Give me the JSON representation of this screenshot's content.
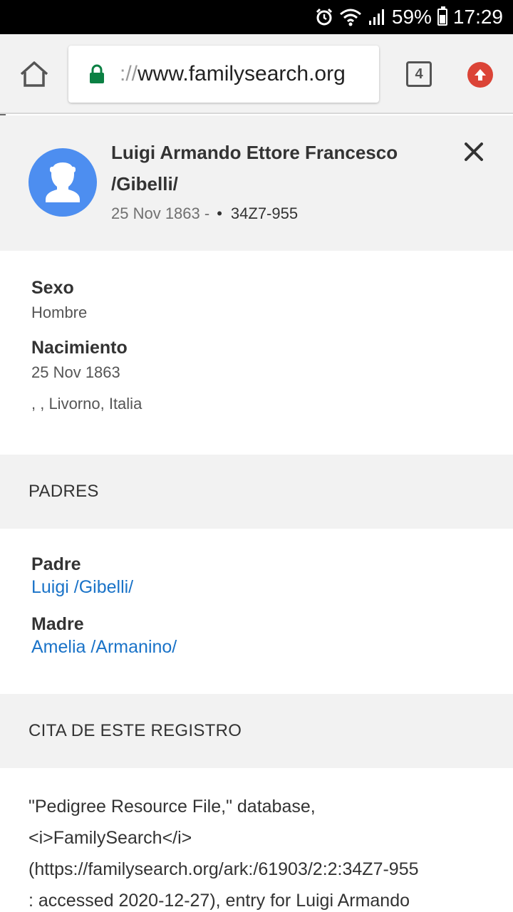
{
  "status_bar": {
    "battery": "59%",
    "time": "17:29"
  },
  "browser": {
    "url_scheme": "://",
    "url_host": "www.familysearch.org",
    "tab_count": "4"
  },
  "person": {
    "name_line1": "Luigi Armando Ettore Francesco",
    "name_line2": "/Gibelli/",
    "dates": "25 Nov 1863 -",
    "separator": "•",
    "pid": "34Z7-955"
  },
  "vitals": {
    "sex_label": "Sexo",
    "sex_value": "Hombre",
    "birth_label": "Nacimiento",
    "birth_date": "25 Nov 1863",
    "birth_place": ", , Livorno, Italia"
  },
  "parents_section": {
    "title": "PADRES",
    "father_label": "Padre",
    "father_name": "Luigi /Gibelli/",
    "mother_label": "Madre",
    "mother_name": "Amelia /Armanino/"
  },
  "citation_section": {
    "title": "CITA DE ESTE REGISTRO",
    "lines": [
      "\"Pedigree Resource File,\" database,",
      "<i>FamilySearch</i>",
      "(https://familysearch.org/ark:/61903/2:2:34Z7-955",
      ": accessed 2020-12-27), entry for Luigi Armando"
    ]
  },
  "colors": {
    "accent_link": "#1a73c8",
    "avatar_bg": "#4d8ef0",
    "lock_green": "#0b8043",
    "update_red": "#db4437"
  },
  "icons": [
    "alarm-icon",
    "wifi-icon",
    "signal-icon",
    "battery-icon",
    "home-icon",
    "lock-icon",
    "tabs-icon",
    "update-icon",
    "avatar-icon",
    "close-icon"
  ]
}
